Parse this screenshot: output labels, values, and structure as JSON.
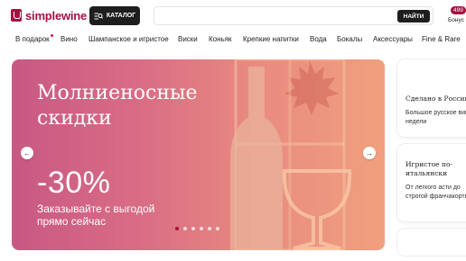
{
  "header": {
    "logo_text": "simplewine",
    "catalog_label": "КАТАЛОГ",
    "search_placeholder": "",
    "search_button": "НАЙТИ",
    "bonus_count": "499",
    "bonus_label": "Бонус"
  },
  "nav": {
    "items": [
      {
        "label": "В подарок",
        "has_dot": true
      },
      {
        "label": "Вино"
      },
      {
        "label": "Шампанское и игристое"
      },
      {
        "label": "Виски"
      },
      {
        "label": "Коньяк"
      },
      {
        "label": "Крепкие напитки"
      },
      {
        "label": "Вода"
      },
      {
        "label": "Бокалы"
      },
      {
        "label": "Аксессуары"
      },
      {
        "label": "Fine & Rare"
      }
    ]
  },
  "banner": {
    "title": "Молниеносные скидки",
    "discount": "-30%",
    "subtitle": "Заказывайте с выгодой прямо сейчас",
    "slides_total": 6,
    "active_slide": 1
  },
  "cards": [
    {
      "title": "Сделано в России",
      "desc": "Большое русское вино недели"
    },
    {
      "title": "Игристое по-итальянски",
      "desc": "От легкого асти до строгой франчакорты"
    }
  ],
  "colors": {
    "brand": "#a3123f",
    "dark": "#1e1e1e",
    "banner_start": "#c85883",
    "banner_end": "#f0a07e"
  }
}
